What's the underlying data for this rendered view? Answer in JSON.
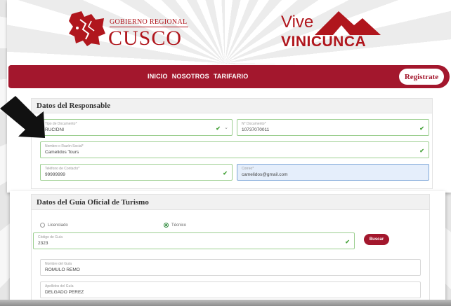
{
  "header": {
    "gob_small": "GOBIERNO REGIONAL",
    "gob_big": "CUSCO",
    "vive": "Vive",
    "vinicunca": "VINICUNCA"
  },
  "nav": {
    "links": [
      "INICIO",
      "NOSOTROS",
      "TARIFARIO"
    ],
    "register_label": "Registrate"
  },
  "responsable": {
    "title": "Datos del Responsable",
    "tipo_doc": {
      "label": "Tipo de Documento*",
      "value": "RUC/DNI"
    },
    "num_doc": {
      "label": "N° Documento*",
      "value": "10737070011"
    },
    "razon_social": {
      "label": "Nombre o Razón Social*",
      "value": "Camelidos Tours"
    },
    "telefono": {
      "label": "Teléfono de Contacto*",
      "value": "99999999"
    },
    "correo": {
      "label": "Correo*",
      "value": "camelidos@gmail.com"
    }
  },
  "guia": {
    "title": "Datos del Guía Oficial de Turismo",
    "radio_licenciado": "Licenciado",
    "radio_tecnico": "Técnico",
    "codigo": {
      "label": "Código de Guía",
      "value": "2323"
    },
    "buscar_label": "Buscar",
    "nombre": {
      "label": "Nombre del Guía",
      "value": "ROMULO REMO"
    },
    "apellidos": {
      "label": "Apellidos del Guía",
      "value": "DELGADO PEREZ"
    }
  },
  "colors": {
    "brand": "#a3172d",
    "logo_red": "#b0161d",
    "valid_green": "#46a23a"
  }
}
